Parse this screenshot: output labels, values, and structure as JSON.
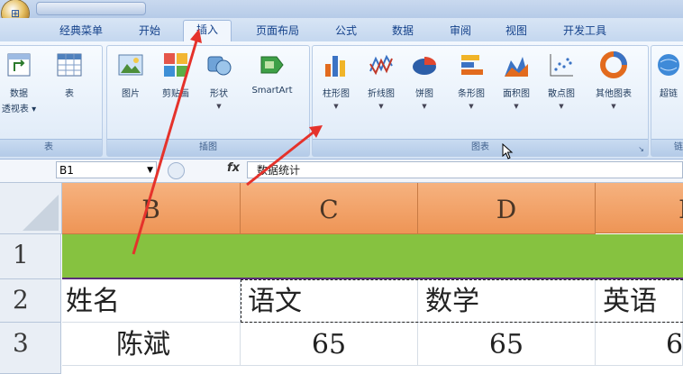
{
  "tabs": [
    "经典菜单",
    "开始",
    "插入",
    "页面布局",
    "公式",
    "数据",
    "审阅",
    "视图",
    "开发工具"
  ],
  "active_tab": "插入",
  "groups": {
    "table": {
      "label": "表",
      "buttons": [
        {
          "label": "数据",
          "label2": "透视表 ▾",
          "icon": "pivot-icon"
        },
        {
          "label": "表",
          "icon": "table-icon"
        }
      ]
    },
    "illustrations": {
      "label": "插图",
      "buttons": [
        {
          "label": "图片",
          "icon": "picture-icon"
        },
        {
          "label": "剪贴画",
          "icon": "clipart-icon"
        },
        {
          "label": "形状",
          "icon": "shapes-icon"
        },
        {
          "label": "SmartArt",
          "icon": "smartart-icon"
        }
      ]
    },
    "charts": {
      "label": "图表",
      "buttons": [
        {
          "label": "柱形图",
          "icon": "column-chart-icon"
        },
        {
          "label": "折线图",
          "icon": "line-chart-icon"
        },
        {
          "label": "饼图",
          "icon": "pie-chart-icon"
        },
        {
          "label": "条形图",
          "icon": "bar-chart-icon"
        },
        {
          "label": "面积图",
          "icon": "area-chart-icon"
        },
        {
          "label": "散点图",
          "icon": "scatter-chart-icon"
        },
        {
          "label": "其他图表",
          "icon": "other-chart-icon"
        }
      ]
    },
    "links": {
      "label": "链",
      "buttons": [
        {
          "label": "超链",
          "icon": "hyperlink-icon"
        }
      ]
    }
  },
  "formula_bar": {
    "name_box": "B1",
    "fx": "fx",
    "content": "数据统计"
  },
  "columns": [
    "B",
    "C",
    "D",
    "E"
  ],
  "rows": [
    "1",
    "2",
    "3"
  ],
  "cells": {
    "row2": [
      "姓名",
      "语文",
      "数学",
      "英语"
    ],
    "row3": [
      "陈斌",
      "65",
      "65",
      "6"
    ]
  },
  "colors": {
    "header_fill": "#ee9556",
    "row1_fill": "#86c240",
    "arrow": "#e5322b"
  }
}
